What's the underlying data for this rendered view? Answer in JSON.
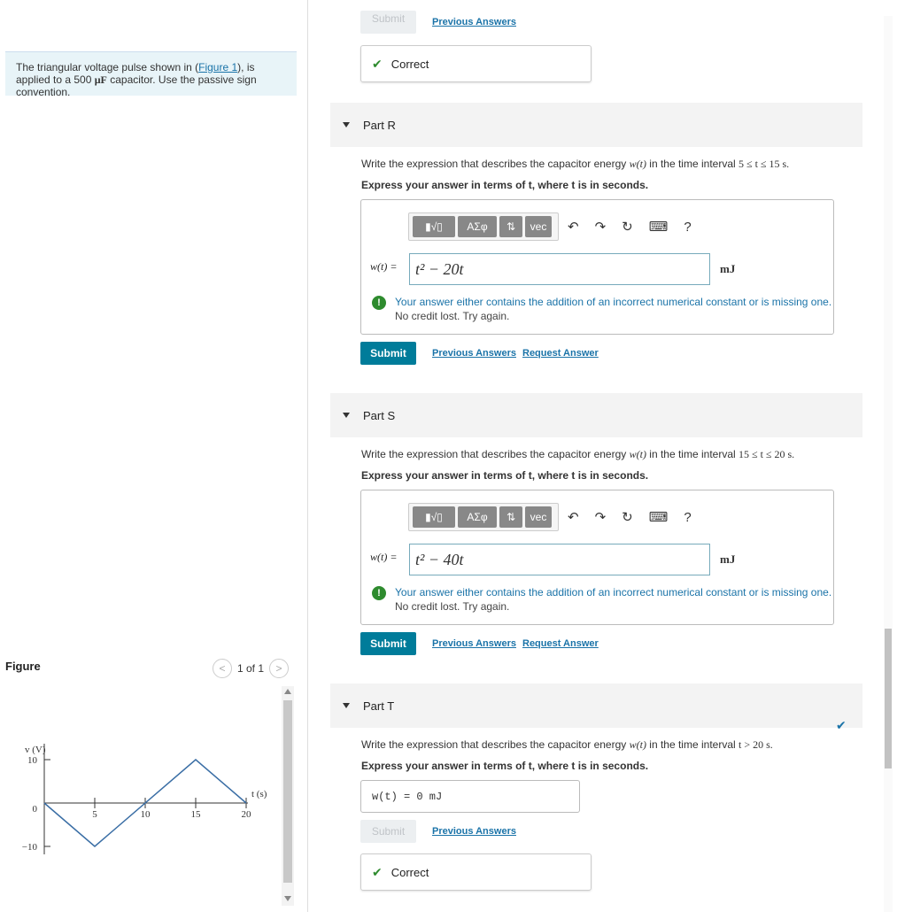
{
  "problem": {
    "text_before": "The triangular voltage pulse shown in (",
    "figure_link": "Figure 1",
    "text_after": "), is applied to a 500 ",
    "unit_mu": "μF",
    "text_end": " capacitor. Use the passive sign convention."
  },
  "figure": {
    "label": "Figure",
    "counter": "1 of 1",
    "ylabel": "v (V)",
    "xlabel": "t (s)",
    "y_ticks": [
      "10",
      "0",
      "−10"
    ],
    "x_ticks": [
      "5",
      "10",
      "15",
      "20"
    ],
    "chart_data": {
      "type": "line",
      "x": [
        0,
        5,
        15,
        20
      ],
      "y": [
        0,
        -10,
        10,
        0
      ],
      "xlim": [
        0,
        20
      ],
      "ylim": [
        -10,
        10
      ],
      "xlabel": "t (s)",
      "ylabel": "v (V)"
    }
  },
  "top": {
    "submit_label": "Submit",
    "prev_answers": "Previous Answers",
    "correct_label": "Correct"
  },
  "partR": {
    "title": "Part R",
    "question_prefix": "Write the expression that describes the capacitor energy ",
    "question_fn": "w(t)",
    "question_mid": " in the time interval ",
    "interval": "5 ≤ t ≤ 15 s.",
    "instruction": "Express your answer in terms of t, where t is in seconds.",
    "eq_label": "w(t) =",
    "answer": "t² − 20t",
    "unit": "mJ",
    "warning1": "Your answer either contains the addition of an incorrect numerical constant or is missing one.",
    "warning2": "No credit lost. Try again.",
    "submit": "Submit",
    "prev_answers": "Previous Answers",
    "request_answer": "Request Answer"
  },
  "partS": {
    "title": "Part S",
    "question_prefix": "Write the expression that describes the capacitor energy ",
    "question_fn": "w(t)",
    "question_mid": " in the time interval ",
    "interval": "15 ≤ t ≤ 20 s.",
    "instruction": "Express your answer in terms of t, where t is in seconds.",
    "eq_label": "w(t) =",
    "answer": "t² − 40t",
    "unit": "mJ",
    "warning1": "Your answer either contains the addition of an incorrect numerical constant or is missing one.",
    "warning2": "No credit lost. Try again.",
    "submit": "Submit",
    "prev_answers": "Previous Answers",
    "request_answer": "Request Answer"
  },
  "partT": {
    "title": "Part T",
    "question_prefix": "Write the expression that describes the capacitor energy ",
    "question_fn": "w(t)",
    "question_mid": " in the time interval ",
    "interval": "t > 20 s.",
    "instruction": "Express your answer in terms of t, where t is in seconds.",
    "answer_display": "w(t) = 0 mJ",
    "submit": "Submit",
    "prev_answers": "Previous Answers",
    "correct_label": "Correct"
  },
  "toolbar": {
    "templates": "▮√▯",
    "greek": "ΑΣφ",
    "arrows": "⇅",
    "vec": "vec",
    "undo": "↶",
    "redo": "↷",
    "reset": "↻",
    "keyboard": "⌨",
    "help": "?"
  }
}
